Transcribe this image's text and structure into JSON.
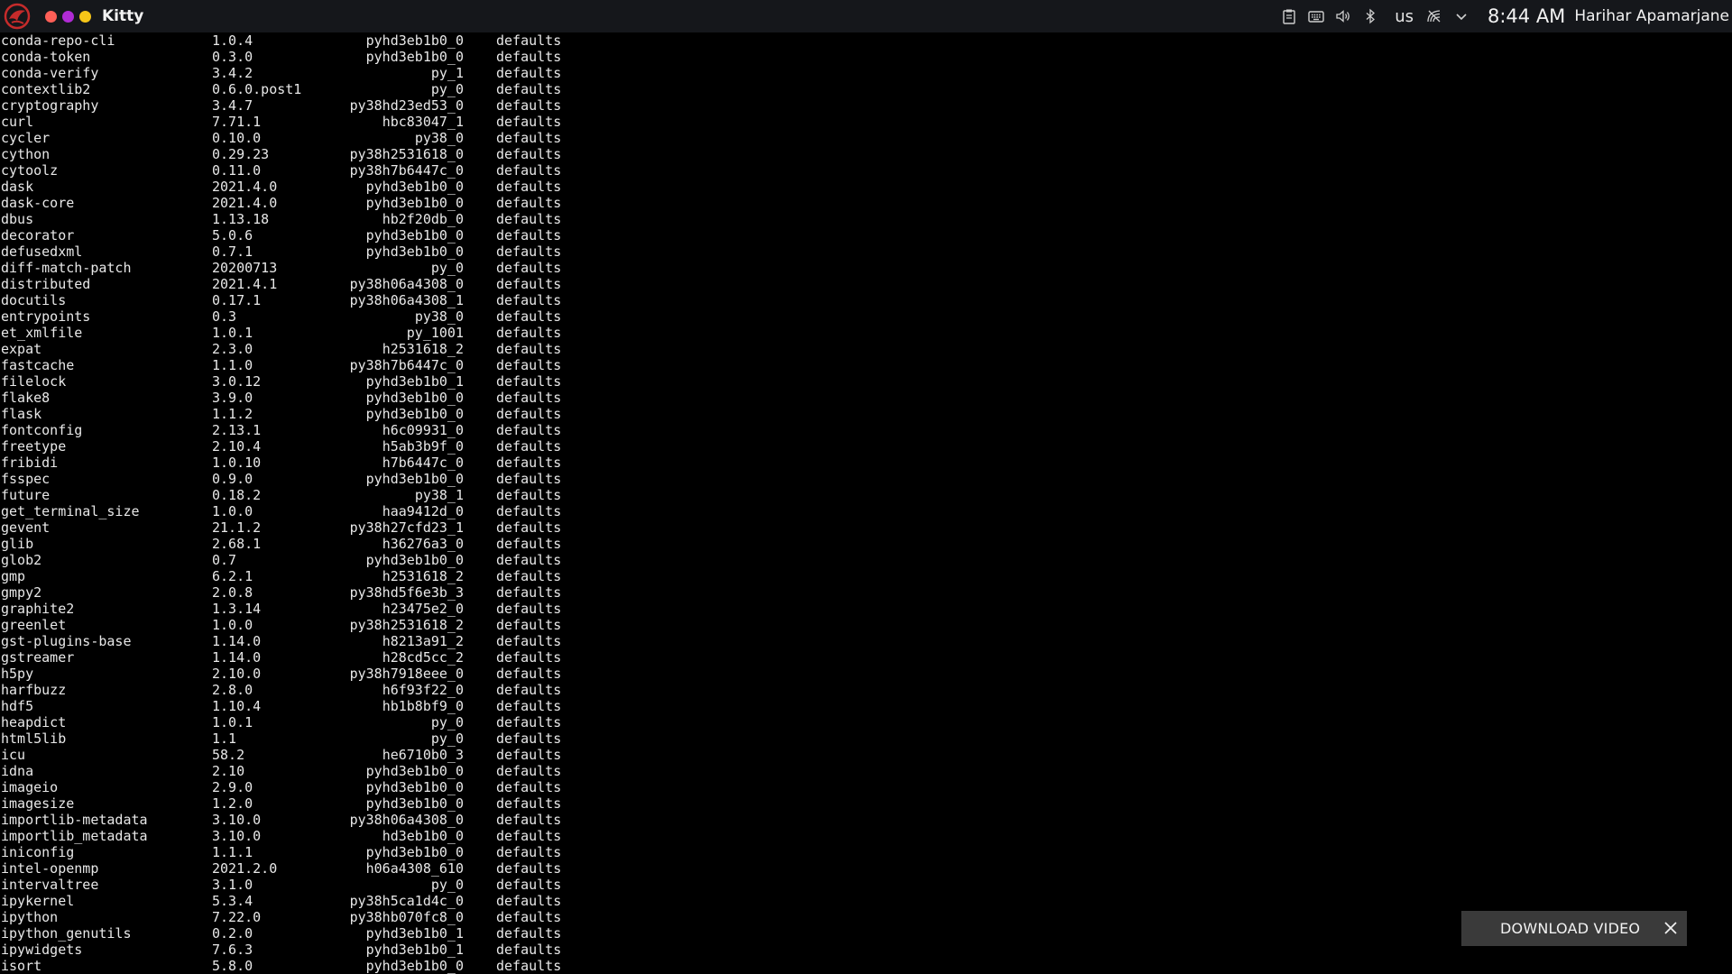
{
  "window": {
    "title": "Kitty"
  },
  "traffic_lights": [
    "#ff5f57",
    "#b02bd4",
    "#f5c518"
  ],
  "tray": {
    "icons": [
      "clipboard-icon",
      "keyboard-icon",
      "volume-icon",
      "bluetooth-icon"
    ],
    "keyboard_layout": "us",
    "network_icon": "wifi-icon",
    "menu_icon": "chevron-down-icon",
    "clock": "8:44 AM",
    "user": "Harihar Apamarjane"
  },
  "packages": [
    [
      "conda-repo-cli",
      "1.0.4",
      "pyhd3eb1b0_0",
      "defaults"
    ],
    [
      "conda-token",
      "0.3.0",
      "pyhd3eb1b0_0",
      "defaults"
    ],
    [
      "conda-verify",
      "3.4.2",
      "py_1",
      "defaults"
    ],
    [
      "contextlib2",
      "0.6.0.post1",
      "py_0",
      "defaults"
    ],
    [
      "cryptography",
      "3.4.7",
      "py38hd23ed53_0",
      "defaults"
    ],
    [
      "curl",
      "7.71.1",
      "hbc83047_1",
      "defaults"
    ],
    [
      "cycler",
      "0.10.0",
      "py38_0",
      "defaults"
    ],
    [
      "cython",
      "0.29.23",
      "py38h2531618_0",
      "defaults"
    ],
    [
      "cytoolz",
      "0.11.0",
      "py38h7b6447c_0",
      "defaults"
    ],
    [
      "dask",
      "2021.4.0",
      "pyhd3eb1b0_0",
      "defaults"
    ],
    [
      "dask-core",
      "2021.4.0",
      "pyhd3eb1b0_0",
      "defaults"
    ],
    [
      "dbus",
      "1.13.18",
      "hb2f20db_0",
      "defaults"
    ],
    [
      "decorator",
      "5.0.6",
      "pyhd3eb1b0_0",
      "defaults"
    ],
    [
      "defusedxml",
      "0.7.1",
      "pyhd3eb1b0_0",
      "defaults"
    ],
    [
      "diff-match-patch",
      "20200713",
      "py_0",
      "defaults"
    ],
    [
      "distributed",
      "2021.4.1",
      "py38h06a4308_0",
      "defaults"
    ],
    [
      "docutils",
      "0.17.1",
      "py38h06a4308_1",
      "defaults"
    ],
    [
      "entrypoints",
      "0.3",
      "py38_0",
      "defaults"
    ],
    [
      "et_xmlfile",
      "1.0.1",
      "py_1001",
      "defaults"
    ],
    [
      "expat",
      "2.3.0",
      "h2531618_2",
      "defaults"
    ],
    [
      "fastcache",
      "1.1.0",
      "py38h7b6447c_0",
      "defaults"
    ],
    [
      "filelock",
      "3.0.12",
      "pyhd3eb1b0_1",
      "defaults"
    ],
    [
      "flake8",
      "3.9.0",
      "pyhd3eb1b0_0",
      "defaults"
    ],
    [
      "flask",
      "1.1.2",
      "pyhd3eb1b0_0",
      "defaults"
    ],
    [
      "fontconfig",
      "2.13.1",
      "h6c09931_0",
      "defaults"
    ],
    [
      "freetype",
      "2.10.4",
      "h5ab3b9f_0",
      "defaults"
    ],
    [
      "fribidi",
      "1.0.10",
      "h7b6447c_0",
      "defaults"
    ],
    [
      "fsspec",
      "0.9.0",
      "pyhd3eb1b0_0",
      "defaults"
    ],
    [
      "future",
      "0.18.2",
      "py38_1",
      "defaults"
    ],
    [
      "get_terminal_size",
      "1.0.0",
      "haa9412d_0",
      "defaults"
    ],
    [
      "gevent",
      "21.1.2",
      "py38h27cfd23_1",
      "defaults"
    ],
    [
      "glib",
      "2.68.1",
      "h36276a3_0",
      "defaults"
    ],
    [
      "glob2",
      "0.7",
      "pyhd3eb1b0_0",
      "defaults"
    ],
    [
      "gmp",
      "6.2.1",
      "h2531618_2",
      "defaults"
    ],
    [
      "gmpy2",
      "2.0.8",
      "py38hd5f6e3b_3",
      "defaults"
    ],
    [
      "graphite2",
      "1.3.14",
      "h23475e2_0",
      "defaults"
    ],
    [
      "greenlet",
      "1.0.0",
      "py38h2531618_2",
      "defaults"
    ],
    [
      "gst-plugins-base",
      "1.14.0",
      "h8213a91_2",
      "defaults"
    ],
    [
      "gstreamer",
      "1.14.0",
      "h28cd5cc_2",
      "defaults"
    ],
    [
      "h5py",
      "2.10.0",
      "py38h7918eee_0",
      "defaults"
    ],
    [
      "harfbuzz",
      "2.8.0",
      "h6f93f22_0",
      "defaults"
    ],
    [
      "hdf5",
      "1.10.4",
      "hb1b8bf9_0",
      "defaults"
    ],
    [
      "heapdict",
      "1.0.1",
      "py_0",
      "defaults"
    ],
    [
      "html5lib",
      "1.1",
      "py_0",
      "defaults"
    ],
    [
      "icu",
      "58.2",
      "he6710b0_3",
      "defaults"
    ],
    [
      "idna",
      "2.10",
      "pyhd3eb1b0_0",
      "defaults"
    ],
    [
      "imageio",
      "2.9.0",
      "pyhd3eb1b0_0",
      "defaults"
    ],
    [
      "imagesize",
      "1.2.0",
      "pyhd3eb1b0_0",
      "defaults"
    ],
    [
      "importlib-metadata",
      "3.10.0",
      "py38h06a4308_0",
      "defaults"
    ],
    [
      "importlib_metadata",
      "3.10.0",
      "hd3eb1b0_0",
      "defaults"
    ],
    [
      "iniconfig",
      "1.1.1",
      "pyhd3eb1b0_0",
      "defaults"
    ],
    [
      "intel-openmp",
      "2021.2.0",
      "h06a4308_610",
      "defaults"
    ],
    [
      "intervaltree",
      "3.1.0",
      "py_0",
      "defaults"
    ],
    [
      "ipykernel",
      "5.3.4",
      "py38h5ca1d4c_0",
      "defaults"
    ],
    [
      "ipython",
      "7.22.0",
      "py38hb070fc8_0",
      "defaults"
    ],
    [
      "ipython_genutils",
      "0.2.0",
      "pyhd3eb1b0_1",
      "defaults"
    ],
    [
      "ipywidgets",
      "7.6.3",
      "pyhd3eb1b0_1",
      "defaults"
    ],
    [
      "isort",
      "5.8.0",
      "pyhd3eb1b0_0",
      "defaults"
    ]
  ],
  "overlay": {
    "label": "DOWNLOAD VIDEO",
    "close_icon": "close-icon"
  }
}
